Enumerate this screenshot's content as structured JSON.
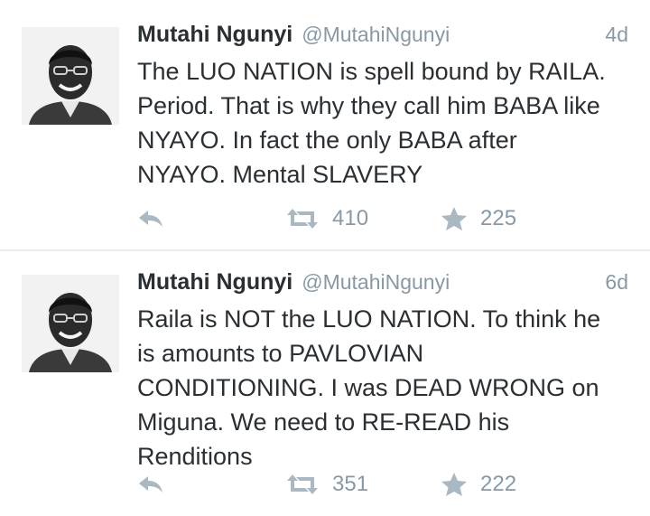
{
  "colors": {
    "text": "#292f33",
    "muted": "#8899a6",
    "icon": "#aab8c2",
    "divider": "#e6ecf0"
  },
  "tweets": [
    {
      "display_name": "Mutahi Ngunyi",
      "handle": "@MutahiNgunyi",
      "time": "4d",
      "text": "The LUO NATION is spell bound by RAILA.\nPeriod. That is why they call him BABA like\nNYAYO. In fact the only BABA after\nNYAYO. Mental SLAVERY",
      "retweets": "410",
      "favorites": "225",
      "icons": [
        "reply-icon",
        "retweet-icon",
        "star-icon"
      ]
    },
    {
      "display_name": "Mutahi Ngunyi",
      "handle": "@MutahiNgunyi",
      "time": "6d",
      "text": "Raila is NOT the LUO NATION. To think he\nis amounts to PAVLOVIAN\nCONDITIONING. I was DEAD WRONG on\nMiguna. We need to RE-READ his\nRenditions",
      "retweets": "351",
      "favorites": "222",
      "icons": [
        "reply-icon",
        "retweet-icon",
        "star-icon"
      ]
    }
  ]
}
